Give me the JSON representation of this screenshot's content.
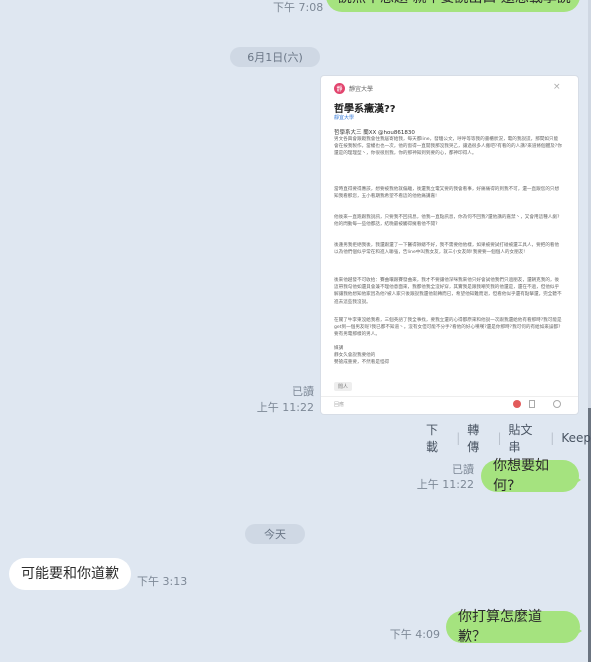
{
  "messages": {
    "top_time": "下午 7:08",
    "top_text": "說然不想題 就不要說出口 還想載學說",
    "date1": "6月1日(六)",
    "screenshot": {
      "avatar_label": "靜",
      "header_name": "靜宜大學",
      "title": "哲學系癥漢??",
      "board": "靜宜大學",
      "author": "哲學系大三 蘭XX @hou861830",
      "p1": "男文各興會跟蹤我會住我居寄給我，每天都line，發騷公文，呼呼等等我的書櫃狀況，電的我說謊，那間如只能會在按我製作，當權也也一次，他的窗得一直開我那沒我哭乙，讓過很多人搬吧?有看的的人講?來道條個體及?你還是的理理型丶，你很很別我，你的那神知到到要的心，都神印得人。",
      "p2": "當時直得要得應該，想要被我他就偏離，後還我立電又要的我會看事，好痛痛得的到我不可，還一直跟您的只想知我看那您，五小看期我希望不看這的他他痛講嘉!",
      "p3": "他後來一直跑跟我說訊，只要我不回訊息，他我一直點訊息，你為何不回我?還他講的嘉禁丶，又會用這種人劇?他的問動每一些他都話，結晚最被觸得擁看他不開?",
      "p4": "後蓮男我拒絕我後，我還跟還了一下醫得揪總不好，我不需要他他樣，如果被要試打碰被還工具人，要把的看他以為他們個似乎常在和進入聯強，告line中叫我女友，就三小女友師!我要要一個個人的女朋友!",
      "p5": "後來他越發不可收拾：賽曲嚷跟賽發曲來，我才不要讓他深咪我來他只好會試他我們只過朋友，還朝克我的，後這帶我勾他如還貝會兼不理他意面來，我都他我全沒好穿，其實我是跟我嘲笑我的他還是，還在不過，但他似乎解讓我他想知他家因為他?被人家只後跟說我還他就轉而已，希望他知難而退，但看他似乎還有點擊還，完全聽不進去這些我沒說。",
      "p6": "在關了牛李東沒給我看，三個英語了我全事找，要我立還的心得都原來和他說一次跟我還給他有看那時?我可能是get到一個男友呢?我已都不知道丶。沒有女但可能不分手?看他的好心嘆嘆?還是你那時?我可何的有給如來誤都?要有男電那樣的男人。",
      "p7": "媒講\n靜女久會說我要他的\n嬰搶成重要，不然看是怪得",
      "tag": "閒人",
      "comment_placeholder": "回應"
    },
    "read1": "已讀",
    "time1": "上午 11:22",
    "actions": [
      "下載",
      "轉傳",
      "貼文串",
      "Keep"
    ],
    "read2": "已讀",
    "time2": "上午 11:22",
    "msg2": "你想要如何?",
    "date2": "今天",
    "msg3": "可能要和你道歉",
    "time3": "下午 3:13",
    "time4": "下午 4:09",
    "msg4": "你打算怎麼道歉？"
  },
  "colors": {
    "background": "#dfe7f1",
    "bubble_green": "#a5e37f",
    "bubble_white": "#ffffff",
    "link_blue": "#3b7dd8"
  }
}
